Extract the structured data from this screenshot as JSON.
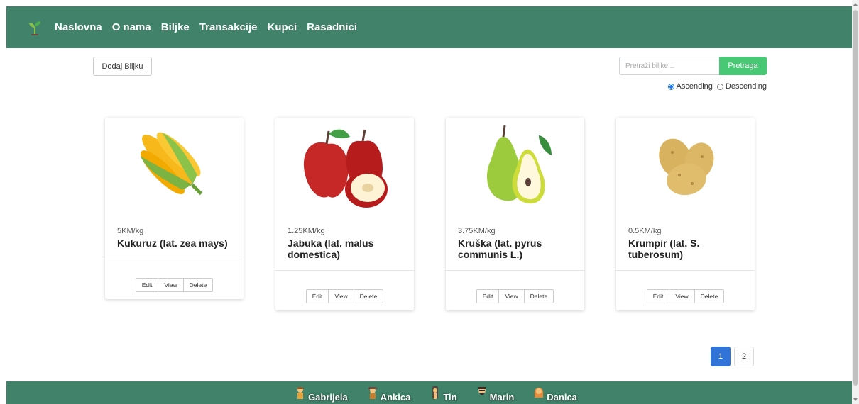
{
  "nav": {
    "logo_icon": "sprout-icon",
    "links": [
      "Naslovna",
      "O nama",
      "Biljke",
      "Transakcije",
      "Kupci",
      "Rasadnici"
    ]
  },
  "toolbar": {
    "add_label": "Dodaj Biljku",
    "search_placeholder": "Pretraži biljke...",
    "search_button": "Pretraga",
    "sort_asc": "Ascending",
    "sort_desc": "Descending",
    "sort_selected": "Ascending"
  },
  "plants": [
    {
      "price": "5KM/kg",
      "name": "Kukuruz (lat. zea mays)",
      "image": "corn-image"
    },
    {
      "price": "1.25KM/kg",
      "name": "Jabuka (lat. malus domestica)",
      "image": "apple-image"
    },
    {
      "price": "3.75KM/kg",
      "name": "Kruška (lat. pyrus communis L.)",
      "image": "pear-image"
    },
    {
      "price": "0.5KM/kg",
      "name": "Krumpir (lat. S. tuberosum)",
      "image": "potato-image"
    }
  ],
  "card_actions": {
    "edit": "Edit",
    "view": "View",
    "delete": "Delete"
  },
  "pagination": {
    "pages": [
      "1",
      "2"
    ],
    "active": "1"
  },
  "footer": {
    "authors": [
      "Gabrijela",
      "Ankica",
      "Tin",
      "Marin",
      "Danica"
    ]
  },
  "colors": {
    "primary": "#41836a",
    "search_button": "#48c774",
    "page_active": "#2f74d6"
  }
}
